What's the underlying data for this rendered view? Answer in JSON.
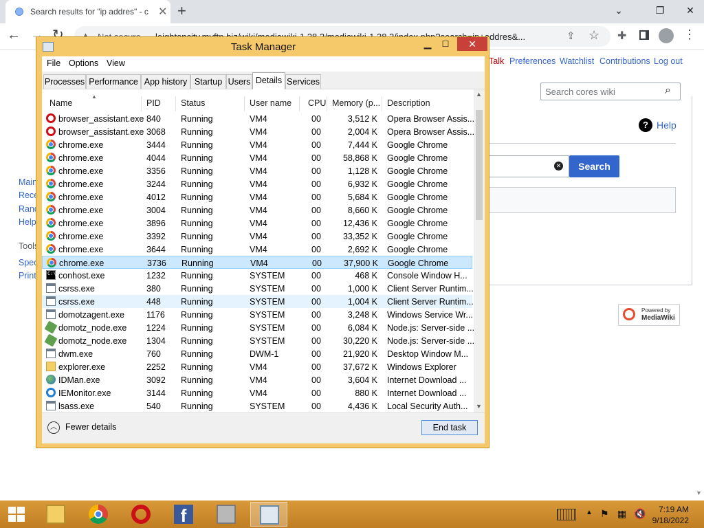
{
  "browser": {
    "tab_title": "Search results for \"ip addres\" - c",
    "tab_close": "✕",
    "new_tab": "+",
    "window_controls": {
      "minimize": "⌄",
      "restore": "❐",
      "close": "✕"
    },
    "not_secure": "Not secure",
    "url": "leightoncity.myftp.biz/wiki/mediawiki-1.38.2/mediawiki-1.38.2/index.php?search=ip+addres&..."
  },
  "wiki": {
    "top_links": [
      "Talk",
      "Preferences",
      "Watchlist",
      "Contributions",
      "Log out"
    ],
    "search_placeholder": "Search cores wiki",
    "help_label": "Help",
    "search_button": "Search",
    "sidebar": [
      "Main",
      "Rece",
      "Rand",
      "Help"
    ],
    "tools_heading": "Tools",
    "tools": [
      "Spec",
      "Print"
    ],
    "powered_by_line1": "Powered by",
    "powered_by_line2": "MediaWiki"
  },
  "taskmanager": {
    "title": "Task Manager",
    "menu": [
      "File",
      "Options",
      "View"
    ],
    "tabs": [
      "Processes",
      "Performance",
      "App history",
      "Startup",
      "Users",
      "Details",
      "Services"
    ],
    "active_tab": "Details",
    "columns": [
      "Name",
      "PID",
      "Status",
      "User name",
      "CPU",
      "Memory (p...",
      "Description"
    ],
    "rows": [
      {
        "icon": "opera-icon",
        "name": "browser_assistant.exe",
        "pid": "840",
        "status": "Running",
        "user": "VM4",
        "cpu": "00",
        "mem": "3,512 K",
        "desc": "Opera Browser Assis..."
      },
      {
        "icon": "opera-icon",
        "name": "browser_assistant.exe",
        "pid": "3068",
        "status": "Running",
        "user": "VM4",
        "cpu": "00",
        "mem": "2,004 K",
        "desc": "Opera Browser Assis..."
      },
      {
        "icon": "chrome-icon",
        "name": "chrome.exe",
        "pid": "3444",
        "status": "Running",
        "user": "VM4",
        "cpu": "00",
        "mem": "7,444 K",
        "desc": "Google Chrome"
      },
      {
        "icon": "chrome-icon",
        "name": "chrome.exe",
        "pid": "4044",
        "status": "Running",
        "user": "VM4",
        "cpu": "00",
        "mem": "58,868 K",
        "desc": "Google Chrome"
      },
      {
        "icon": "chrome-icon",
        "name": "chrome.exe",
        "pid": "3356",
        "status": "Running",
        "user": "VM4",
        "cpu": "00",
        "mem": "1,128 K",
        "desc": "Google Chrome"
      },
      {
        "icon": "chrome-icon",
        "name": "chrome.exe",
        "pid": "3244",
        "status": "Running",
        "user": "VM4",
        "cpu": "00",
        "mem": "6,932 K",
        "desc": "Google Chrome"
      },
      {
        "icon": "chrome-icon",
        "name": "chrome.exe",
        "pid": "4012",
        "status": "Running",
        "user": "VM4",
        "cpu": "00",
        "mem": "5,684 K",
        "desc": "Google Chrome"
      },
      {
        "icon": "chrome-icon",
        "name": "chrome.exe",
        "pid": "3004",
        "status": "Running",
        "user": "VM4",
        "cpu": "00",
        "mem": "8,660 K",
        "desc": "Google Chrome"
      },
      {
        "icon": "chrome-icon",
        "name": "chrome.exe",
        "pid": "3896",
        "status": "Running",
        "user": "VM4",
        "cpu": "00",
        "mem": "12,436 K",
        "desc": "Google Chrome"
      },
      {
        "icon": "chrome-icon",
        "name": "chrome.exe",
        "pid": "3392",
        "status": "Running",
        "user": "VM4",
        "cpu": "00",
        "mem": "33,352 K",
        "desc": "Google Chrome"
      },
      {
        "icon": "chrome-icon",
        "name": "chrome.exe",
        "pid": "3644",
        "status": "Running",
        "user": "VM4",
        "cpu": "00",
        "mem": "2,692 K",
        "desc": "Google Chrome"
      },
      {
        "icon": "chrome-icon",
        "name": "chrome.exe",
        "pid": "3736",
        "status": "Running",
        "user": "VM4",
        "cpu": "00",
        "mem": "37,900 K",
        "desc": "Google Chrome",
        "selected": true
      },
      {
        "icon": "console-icon",
        "name": "conhost.exe",
        "pid": "1232",
        "status": "Running",
        "user": "SYSTEM",
        "cpu": "00",
        "mem": "468 K",
        "desc": "Console Window H..."
      },
      {
        "icon": "window-icon",
        "name": "csrss.exe",
        "pid": "380",
        "status": "Running",
        "user": "SYSTEM",
        "cpu": "00",
        "mem": "1,000 K",
        "desc": "Client Server Runtim..."
      },
      {
        "icon": "window-icon",
        "name": "csrss.exe",
        "pid": "448",
        "status": "Running",
        "user": "SYSTEM",
        "cpu": "00",
        "mem": "1,004 K",
        "desc": "Client Server Runtim...",
        "hover": true
      },
      {
        "icon": "window-icon",
        "name": "domotzagent.exe",
        "pid": "1176",
        "status": "Running",
        "user": "SYSTEM",
        "cpu": "00",
        "mem": "3,248 K",
        "desc": "Windows Service Wr..."
      },
      {
        "icon": "node-icon",
        "name": "domotz_node.exe",
        "pid": "1224",
        "status": "Running",
        "user": "SYSTEM",
        "cpu": "00",
        "mem": "6,084 K",
        "desc": "Node.js: Server-side ..."
      },
      {
        "icon": "node-icon",
        "name": "domotz_node.exe",
        "pid": "1304",
        "status": "Running",
        "user": "SYSTEM",
        "cpu": "00",
        "mem": "30,220 K",
        "desc": "Node.js: Server-side ..."
      },
      {
        "icon": "window-icon",
        "name": "dwm.exe",
        "pid": "760",
        "status": "Running",
        "user": "DWM-1",
        "cpu": "00",
        "mem": "21,920 K",
        "desc": "Desktop Window M..."
      },
      {
        "icon": "explorer-icon",
        "name": "explorer.exe",
        "pid": "2252",
        "status": "Running",
        "user": "VM4",
        "cpu": "00",
        "mem": "37,672 K",
        "desc": "Windows Explorer"
      },
      {
        "icon": "idm-icon",
        "name": "IDMan.exe",
        "pid": "3092",
        "status": "Running",
        "user": "VM4",
        "cpu": "00",
        "mem": "3,604 K",
        "desc": "Internet Download ..."
      },
      {
        "icon": "ie-icon",
        "name": "IEMonitor.exe",
        "pid": "3144",
        "status": "Running",
        "user": "VM4",
        "cpu": "00",
        "mem": "880 K",
        "desc": "Internet Download ..."
      },
      {
        "icon": "window-icon",
        "name": "lsass.exe",
        "pid": "540",
        "status": "Running",
        "user": "SYSTEM",
        "cpu": "00",
        "mem": "4,436 K",
        "desc": "Local Security Auth..."
      }
    ],
    "fewer_details": "Fewer details",
    "end_task": "End task"
  },
  "taskbar": {
    "apps": [
      "file-explorer-icon",
      "chrome-icon",
      "opera-icon",
      "facebook-icon",
      "network-icon",
      "task-manager-icon"
    ],
    "facebook_glyph": "f",
    "time": "7:19 AM",
    "date": "9/18/2022"
  }
}
